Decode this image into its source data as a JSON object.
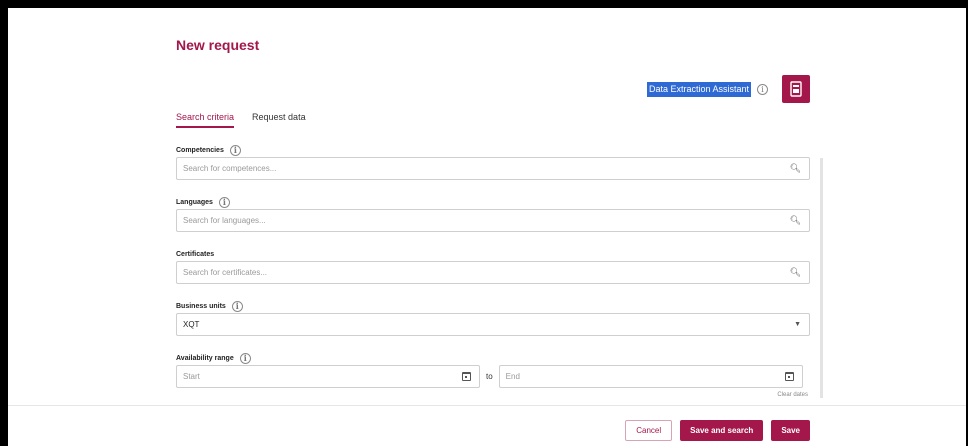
{
  "page": {
    "title": "New request"
  },
  "assistant": {
    "label": "Data Extraction Assistant",
    "info": "i",
    "icon": "document-icon"
  },
  "tabs": [
    {
      "label": "Search criteria",
      "active": true
    },
    {
      "label": "Request data",
      "active": false
    }
  ],
  "fields": {
    "competencies": {
      "label": "Competencies",
      "placeholder": "Search for competences..."
    },
    "languages": {
      "label": "Languages",
      "placeholder": "Search for languages..."
    },
    "certificates": {
      "label": "Certificates",
      "placeholder": "Search for certificates..."
    },
    "business_units": {
      "label": "Business units",
      "value": "XQT"
    },
    "availability": {
      "label": "Availability range",
      "start_placeholder": "Start",
      "to": "to",
      "end_placeholder": "End",
      "clear": "Clear dates"
    }
  },
  "actions": {
    "cancel": "Cancel",
    "save_and_search": "Save and search",
    "save": "Save"
  },
  "colors": {
    "accent": "#a3174a",
    "highlight": "#2f69d3"
  }
}
